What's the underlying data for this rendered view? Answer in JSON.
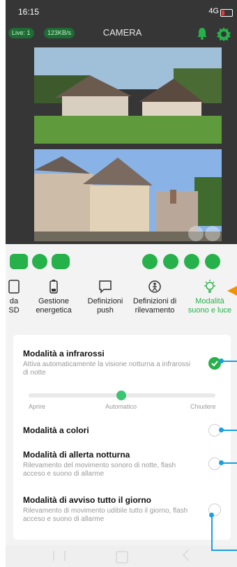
{
  "status": {
    "time": "16:15",
    "network": "4G"
  },
  "appbar": {
    "live_badge": "Live: 1",
    "rate_badge": "123KB/s",
    "title": "CAMERA"
  },
  "tabs": [
    {
      "label": "da SD"
    },
    {
      "label": "Gestione energetica"
    },
    {
      "label": "Definizioni push"
    },
    {
      "label": "Definizioni di rilevamento"
    },
    {
      "label": "Modalità suono e luce"
    }
  ],
  "settings": {
    "infrared": {
      "title": "Modalità a infrarossi",
      "desc": "Attiva automaticamente la visione notturna a infrarossi di notte",
      "enabled": true
    },
    "slider": {
      "left": "Aprire",
      "middle": "Automatico",
      "right": "Chiudere"
    },
    "color": {
      "title": "Modalità a colori",
      "enabled": false
    },
    "night_alert": {
      "title": "Modalità di allerta notturna",
      "desc": "Rilevamento del movimento sonoro di notte, flash acceso e suono di allarme",
      "enabled": false
    },
    "all_day": {
      "title": "Modalità di avviso tutto il giorno",
      "desc": "Rilevamento di movimento udibile tutto il giorno, flash acceso e suono di allarme",
      "enabled": false
    }
  },
  "colors": {
    "accent": "#27b14a",
    "callout": "#1a9fe0",
    "arrow": "#f39200",
    "dark": "#363636"
  }
}
